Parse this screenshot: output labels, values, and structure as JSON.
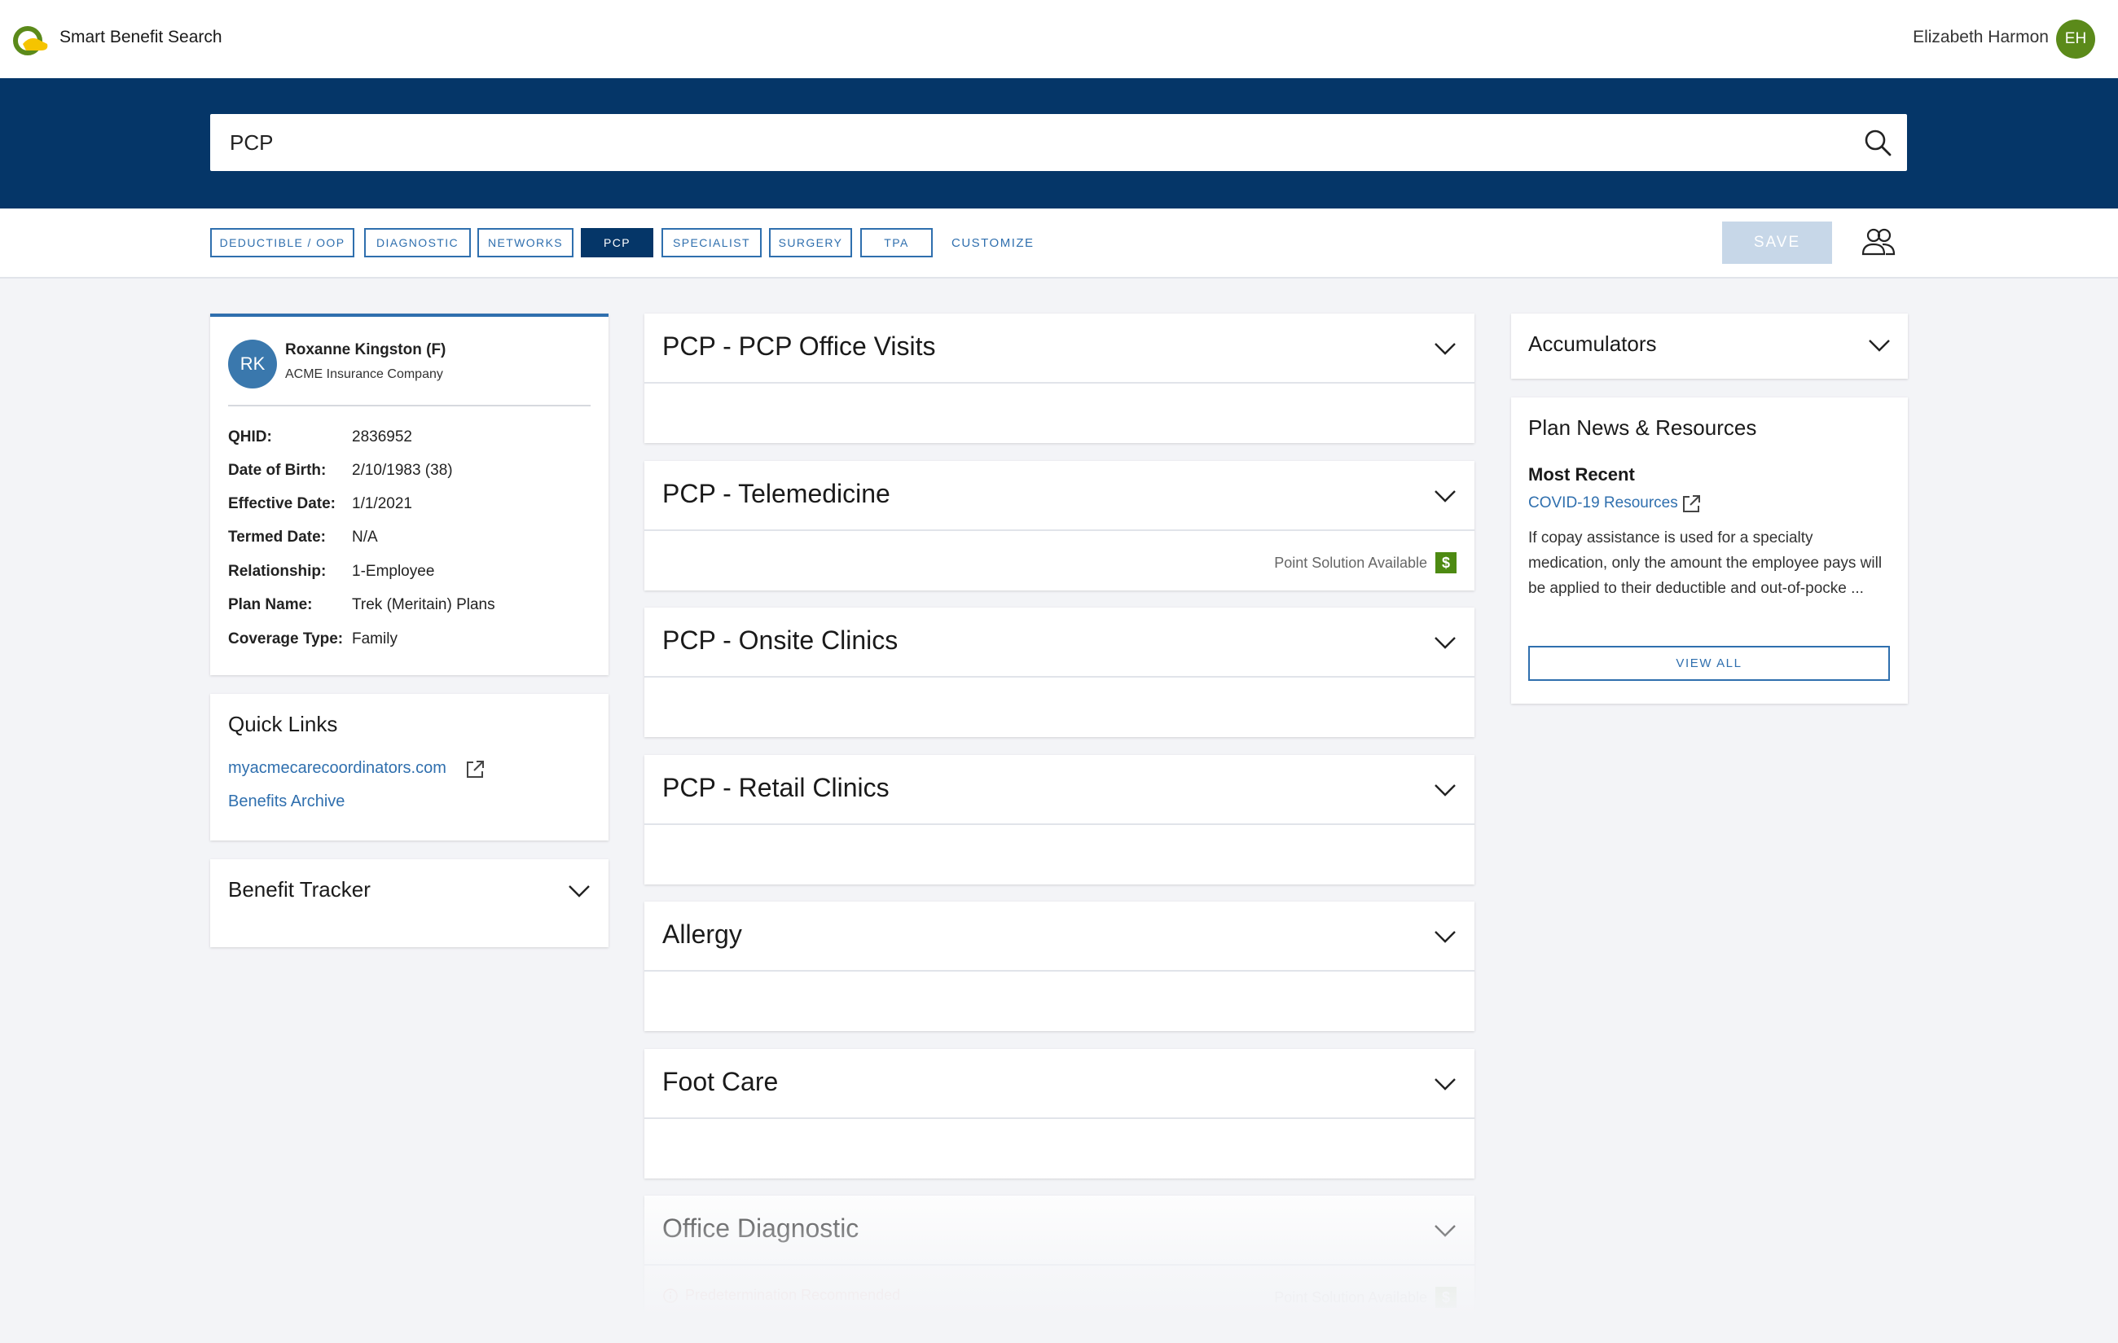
{
  "header": {
    "app_title": "Smart Benefit Search",
    "user_name": "Elizabeth Harmon",
    "user_initials": "EH"
  },
  "search": {
    "value": "PCP",
    "placeholder": ""
  },
  "chips": [
    {
      "label": "DEDUCTIBLE / OOP",
      "active": false
    },
    {
      "label": "DIAGNOSTIC",
      "active": false
    },
    {
      "label": "NETWORKS",
      "active": false
    },
    {
      "label": "PCP",
      "active": true
    },
    {
      "label": "SPECIALIST",
      "active": false
    },
    {
      "label": "SURGERY",
      "active": false
    },
    {
      "label": "TPA",
      "active": false
    }
  ],
  "customize_label": "CUSTOMIZE",
  "save_label": "SAVE",
  "member": {
    "initials": "RK",
    "name": "Roxanne Kingston (F)",
    "company": "ACME Insurance Company",
    "fields": [
      {
        "label": "QHID:",
        "value": "2836952"
      },
      {
        "label": "Date of Birth:",
        "value": "2/10/1983 (38)"
      },
      {
        "label": "Effective Date:",
        "value": "1/1/2021"
      },
      {
        "label": "Termed Date:",
        "value": "N/A"
      },
      {
        "label": "Relationship:",
        "value": "1-Employee"
      },
      {
        "label": "Plan Name:",
        "value": "Trek (Meritain) Plans"
      },
      {
        "label": "Coverage Type:",
        "value": "Family"
      }
    ]
  },
  "quick_links": {
    "title": "Quick Links",
    "links": [
      "myacmecarecoordinators.com",
      "Benefits Archive"
    ]
  },
  "benefit_tracker": {
    "title": "Benefit Tracker"
  },
  "benefits": [
    {
      "title": "PCP - PCP Office Visits",
      "foot_right": "",
      "foot_left": ""
    },
    {
      "title": "PCP - Telemedicine",
      "foot_right": "Point Solution Available",
      "foot_left": ""
    },
    {
      "title": "PCP - Onsite Clinics",
      "foot_right": "",
      "foot_left": ""
    },
    {
      "title": "PCP - Retail Clinics",
      "foot_right": "",
      "foot_left": ""
    },
    {
      "title": "Allergy",
      "foot_right": "",
      "foot_left": ""
    },
    {
      "title": "Foot Care",
      "foot_right": "",
      "foot_left": ""
    },
    {
      "title": "Office Diagnostic",
      "foot_right": "Point Solution Available",
      "foot_left": "Predetermination Recommended"
    }
  ],
  "accumulators": {
    "title": "Accumulators"
  },
  "news": {
    "title": "Plan News & Resources",
    "subtitle": "Most Recent",
    "link": "COVID-19 Resources",
    "body": "If copay assistance is used for a specialty medication, only the amount the employee pays will be applied to their deductible and out-of-pocke ...",
    "button": "VIEW ALL"
  },
  "colors": {
    "brand_navy": "#053668",
    "link_blue": "#2f6fae",
    "avatar_green": "#5b8a1a",
    "point_solution_green": "#4d8a12"
  }
}
